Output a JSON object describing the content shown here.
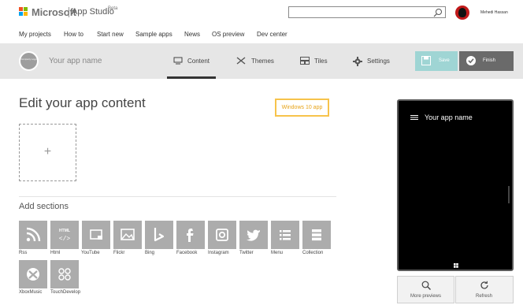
{
  "header": {
    "brand": "Microsoft",
    "product": "App Studio",
    "badge": "Beta",
    "user_name": "Mehedi Hassan",
    "search": {
      "value": "",
      "placeholder": ""
    },
    "nav": [
      "My projects",
      "How to",
      "Start new",
      "Sample apps",
      "News",
      "OS preview",
      "Dev center"
    ]
  },
  "app_bar": {
    "app_name": "Your app name",
    "logo_text": "Company Logo",
    "tabs": [
      "Content",
      "Themes",
      "Tiles",
      "Settings"
    ],
    "active_tab": "Content",
    "save_label": "Save",
    "finish_label": "Finish"
  },
  "main": {
    "title": "Edit your app content",
    "platform_button": "Windows 10 app",
    "add_symbol": "+",
    "sections_title": "Add sections",
    "sections": [
      {
        "label": "Rss",
        "icon": "rss-icon"
      },
      {
        "label": "Html",
        "icon": "html-icon"
      },
      {
        "label": "YouTube",
        "icon": "youtube-icon"
      },
      {
        "label": "Flickr",
        "icon": "flickr-icon"
      },
      {
        "label": "Bing",
        "icon": "bing-icon"
      },
      {
        "label": "Facebook",
        "icon": "facebook-icon"
      },
      {
        "label": "Instagram",
        "icon": "instagram-icon"
      },
      {
        "label": "Twitter",
        "icon": "twitter-icon"
      },
      {
        "label": "Menu",
        "icon": "menu-icon"
      },
      {
        "label": "Collection",
        "icon": "collection-icon"
      },
      {
        "label": "XboxMusic",
        "icon": "xbox-music-icon"
      },
      {
        "label": "TouchDevelop",
        "icon": "touchdevelop-icon"
      }
    ],
    "html_tile_text": "HTML"
  },
  "preview": {
    "app_title": "Your app name",
    "more_previews": "More previews",
    "refresh": "Refresh"
  },
  "colors": {
    "save": "#9fd5d4",
    "finish": "#6a6a6a",
    "platform_accent": "#f7c34b",
    "tile": "#acacac"
  }
}
